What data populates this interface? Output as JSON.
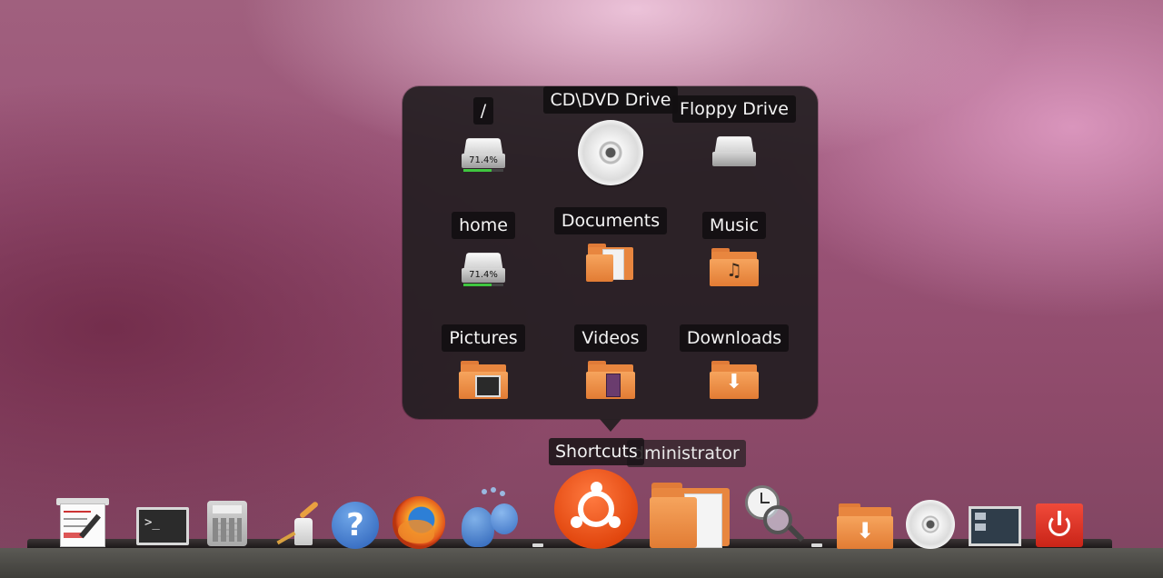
{
  "stack": {
    "title": "Shortcuts",
    "items": [
      {
        "label": "/",
        "icon": "hard-drive-icon",
        "usage": "71.4%",
        "usage_fraction": 0.714
      },
      {
        "label": "CD\\DVD Drive",
        "icon": "cd-dvd-icon"
      },
      {
        "label": "Floppy Drive",
        "icon": "floppy-drive-icon"
      },
      {
        "label": "home",
        "icon": "hard-drive-icon",
        "usage": "71.4%",
        "usage_fraction": 0.714
      },
      {
        "label": "Documents",
        "icon": "documents-folder-icon"
      },
      {
        "label": "Music",
        "icon": "music-folder-icon"
      },
      {
        "label": "Pictures",
        "icon": "pictures-folder-icon"
      },
      {
        "label": "Videos",
        "icon": "videos-folder-icon"
      },
      {
        "label": "Downloads",
        "icon": "downloads-folder-icon"
      }
    ]
  },
  "dock": {
    "tooltips": {
      "shortcuts": "Shortcuts",
      "administrator": "dministrator"
    },
    "items": [
      {
        "name": "text-editor",
        "icon": "text-editor-icon"
      },
      {
        "name": "terminal",
        "icon": "terminal-icon",
        "glyph": ">_"
      },
      {
        "name": "calculator",
        "icon": "calculator-icon"
      },
      {
        "name": "system-cleaner",
        "icon": "broom-icon"
      },
      {
        "name": "help",
        "icon": "help-icon",
        "glyph": "?"
      },
      {
        "name": "firefox",
        "icon": "firefox-icon"
      },
      {
        "name": "empathy",
        "icon": "chat-icon"
      },
      {
        "name": "shortcuts",
        "icon": "ubuntu-logo-icon"
      },
      {
        "name": "administrator",
        "icon": "home-folder-icon"
      },
      {
        "name": "search",
        "icon": "search-icon"
      },
      {
        "name": "downloads-stack",
        "icon": "downloads-folder-icon"
      },
      {
        "name": "cd-dvd",
        "icon": "cd-dvd-icon"
      },
      {
        "name": "desktop",
        "icon": "show-desktop-icon"
      },
      {
        "name": "shutdown",
        "icon": "power-icon"
      }
    ]
  }
}
